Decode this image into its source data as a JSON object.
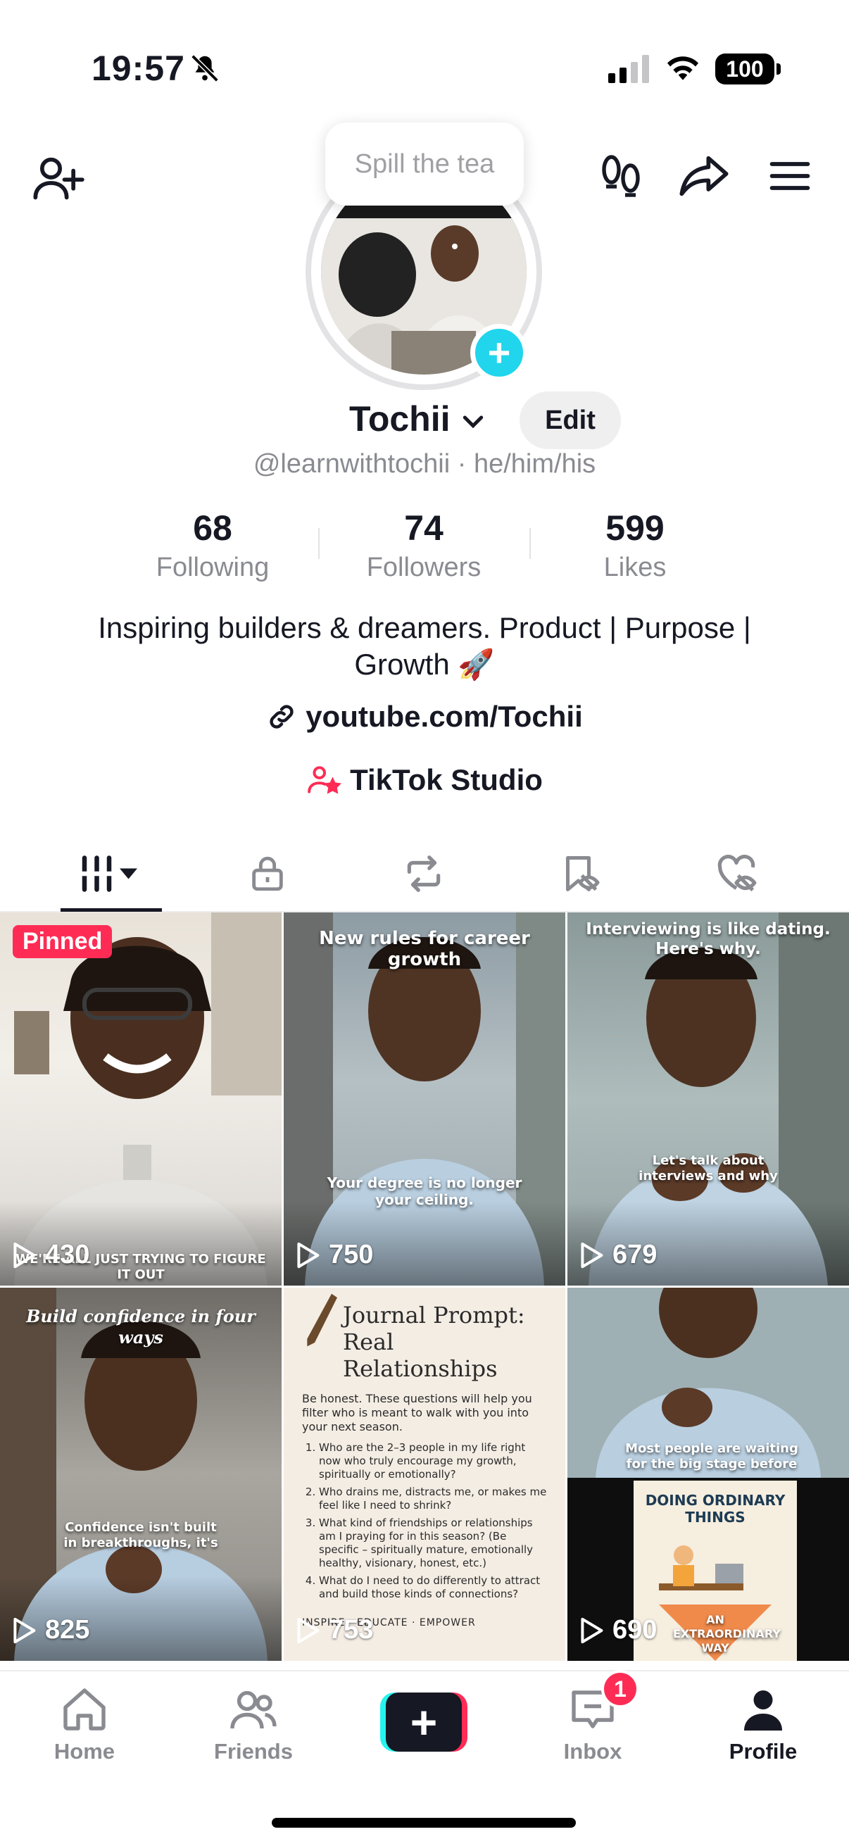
{
  "status_bar": {
    "time": "19:57",
    "battery": "100",
    "icons": [
      "bell-slash-icon",
      "signal-icon",
      "wifi-icon",
      "battery-icon"
    ]
  },
  "top_nav": {
    "icons": [
      "add-friend-icon",
      "footprints-icon",
      "share-icon",
      "menu-icon"
    ]
  },
  "tooltip": {
    "text": "Spill the tea"
  },
  "profile": {
    "username": "Tochii",
    "edit_label": "Edit",
    "handle_line": "@learnwithtochii · he/him/his",
    "stats": [
      {
        "value": "68",
        "label": "Following"
      },
      {
        "value": "74",
        "label": "Followers"
      },
      {
        "value": "599",
        "label": "Likes"
      }
    ],
    "bio": "Inspiring builders & dreamers. Product | Purpose | Growth 🚀",
    "link": "youtube.com/Tochii",
    "studio": "TikTok Studio"
  },
  "tabs": [
    "videos-grid-icon",
    "lock-icon",
    "repost-icon",
    "favorites-hidden-icon",
    "liked-hidden-icon"
  ],
  "videos": [
    {
      "pinned_label": "Pinned",
      "views": "430",
      "caption": "WE'RE ALL JUST TRYING TO FIGURE IT OUT"
    },
    {
      "views": "750",
      "caption_top": "New rules for career growth",
      "caption_bottom": "Your degree is no longer your ceiling."
    },
    {
      "views": "679",
      "caption_top": "Interviewing is like dating. Here's why.",
      "caption_bottom": "Let's talk about interviews and why"
    },
    {
      "views": "825",
      "caption_top": "Build confidence in four ways",
      "caption_bottom": "Confidence isn't built in breakthroughs, it's"
    },
    {
      "views": "753",
      "journal_title": "Journal Prompt: Real Relationships",
      "journal_intro": "Be honest. These questions will help you filter who is meant to walk with you into your next season.",
      "journal_items": [
        "Who are the 2–3 people in my life right now who truly encourage my growth, spiritually or emotionally?",
        "Who drains me, distracts me, or makes me feel like I need to shrink?",
        "What kind of friendships or relationships am I praying for in this season? (Be specific – spiritually mature, emotionally healthy, visionary, honest, etc.)",
        "What do I need to do differently to attract and build those kinds of connections?"
      ],
      "journal_footer": "INSPIRE · EDUCATE · EMPOWER"
    },
    {
      "views": "690",
      "caption_top": "Most people are waiting for the big stage before",
      "poster_title": "DOING ORDINARY THINGS",
      "poster_sub": "AN EXTRAORDINARY WAY"
    }
  ],
  "bottom_nav": {
    "items": [
      {
        "label": "Home",
        "icon": "home-icon"
      },
      {
        "label": "Friends",
        "icon": "friends-icon"
      },
      {
        "label": "",
        "icon": "create-icon"
      },
      {
        "label": "Inbox",
        "icon": "inbox-icon"
      },
      {
        "label": "Profile",
        "icon": "profile-icon"
      }
    ],
    "inbox_badge": "1"
  },
  "colors": {
    "accent_red": "#fe2c55",
    "accent_cyan": "#25f4ee",
    "plus_badge": "#20d5ec",
    "text_primary": "#161823",
    "text_secondary": "#8a8b91"
  }
}
